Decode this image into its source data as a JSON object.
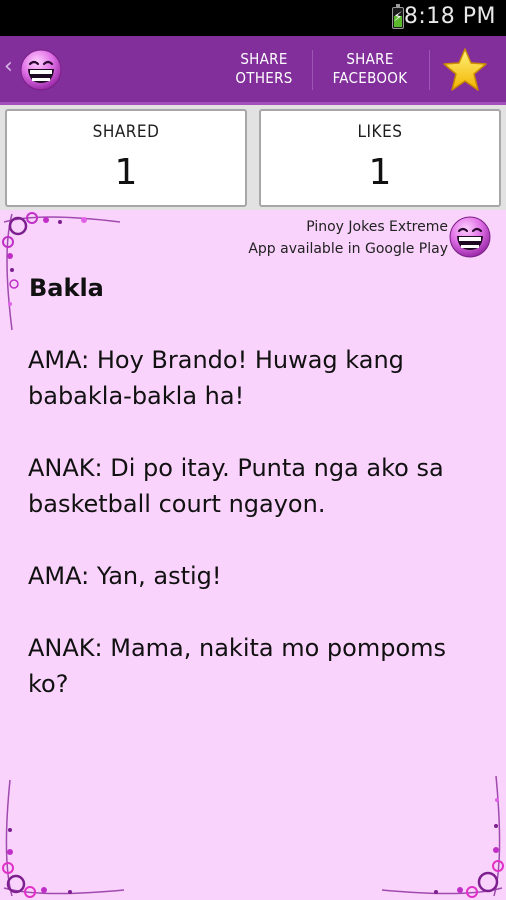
{
  "status_bar": {
    "time": "8:18 PM",
    "battery_icon": "battery-charging-icon",
    "bolt": "⚡"
  },
  "action_bar": {
    "back_glyph": "‹",
    "logo_icon": "laughing-face-icon",
    "share_others_line1": "SHARE",
    "share_others_line2": "OTHERS",
    "share_facebook_line1": "SHARE",
    "share_facebook_line2": "FACEBOOK",
    "favorite_icon": "star-icon",
    "background": "#822f9c"
  },
  "stats": {
    "shared_label": "SHARED",
    "shared_value": "1",
    "likes_label": "LIKES",
    "likes_value": "1"
  },
  "joke": {
    "promo_line1": "Pinoy Jokes Extreme",
    "promo_line2": "App available in Google Play",
    "title": "Bakla",
    "paragraphs": [
      "AMA: Hoy Brando! Huwag kang babakla-bakla ha!",
      "ANAK: Di po itay. Punta nga ako sa basketball court ngayon.",
      "AMA: Yan, astig!",
      "ANAK: Mama, nakita mo pompoms ko?"
    ],
    "background": "#fad3fc"
  }
}
